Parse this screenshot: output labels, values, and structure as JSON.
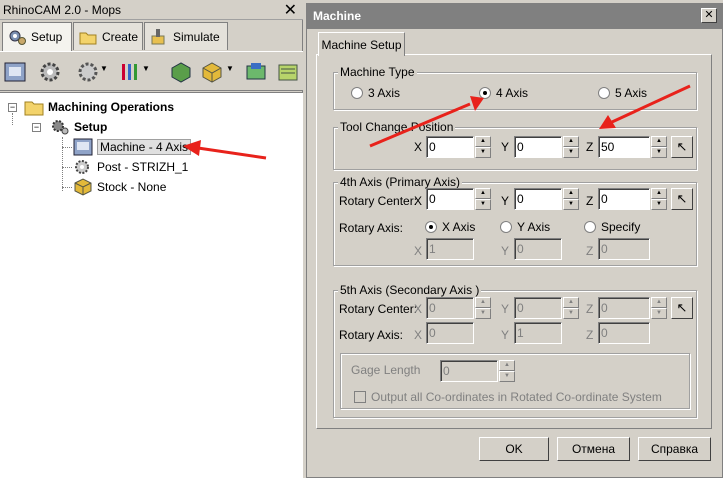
{
  "left_panel": {
    "title": "RhinoCAM 2.0 - Mops",
    "close_glyph": "✕",
    "tabs": [
      {
        "label": "Setup",
        "icon": "setup-gear-icon"
      },
      {
        "label": "Create",
        "icon": "folder-icon"
      },
      {
        "label": "Simulate",
        "icon": "simulate-icon"
      }
    ],
    "tree": {
      "root": "Machining Operations",
      "setup": "Setup",
      "items": [
        "Machine - 4 Axis",
        "Post - STRIZH_1",
        "Stock - None"
      ]
    }
  },
  "dialog": {
    "title": "Machine",
    "close_glyph": "✕",
    "tab": "Machine Setup",
    "machine_type": {
      "label": "Machine Type",
      "options": [
        "3 Axis",
        "4 Axis",
        "5 Axis"
      ],
      "selected": "4 Axis"
    },
    "tool_change": {
      "label": "Tool Change Position",
      "x_label": "X",
      "x": "0",
      "y_label": "Y",
      "y": "0",
      "z_label": "Z",
      "z": "50"
    },
    "axis4": {
      "label": "4th Axis (Primary Axis)",
      "rotary_center_label": "Rotary Center:",
      "x_label": "X",
      "x": "0",
      "y_label": "Y",
      "y": "0",
      "z_label": "Z",
      "z": "0",
      "rotary_axis_label": "Rotary Axis:",
      "axis_options": [
        "X Axis",
        "Y Axis",
        "Specify"
      ],
      "selected": "X Axis",
      "vx": "1",
      "vy": "0",
      "vz": "0"
    },
    "axis5": {
      "label": "5th Axis (Secondary Axis )",
      "rotary_center_label": "Rotary Center:",
      "x_label": "X",
      "x": "0",
      "y_label": "Y",
      "y": "0",
      "z_label": "Z",
      "z": "0",
      "rotary_axis_label": "Rotary Axis:",
      "vx": "0",
      "vy": "1",
      "vz": "0",
      "gage_label": "Gage Length",
      "gage": "0",
      "output_label": "Output all Co-ordinates in Rotated Co-ordinate System"
    },
    "buttons": {
      "ok": "OK",
      "cancel": "Отмена",
      "help": "Справка"
    }
  },
  "colors": {
    "arrow": "#e8221b",
    "dialog_title_bg": "#808080"
  }
}
